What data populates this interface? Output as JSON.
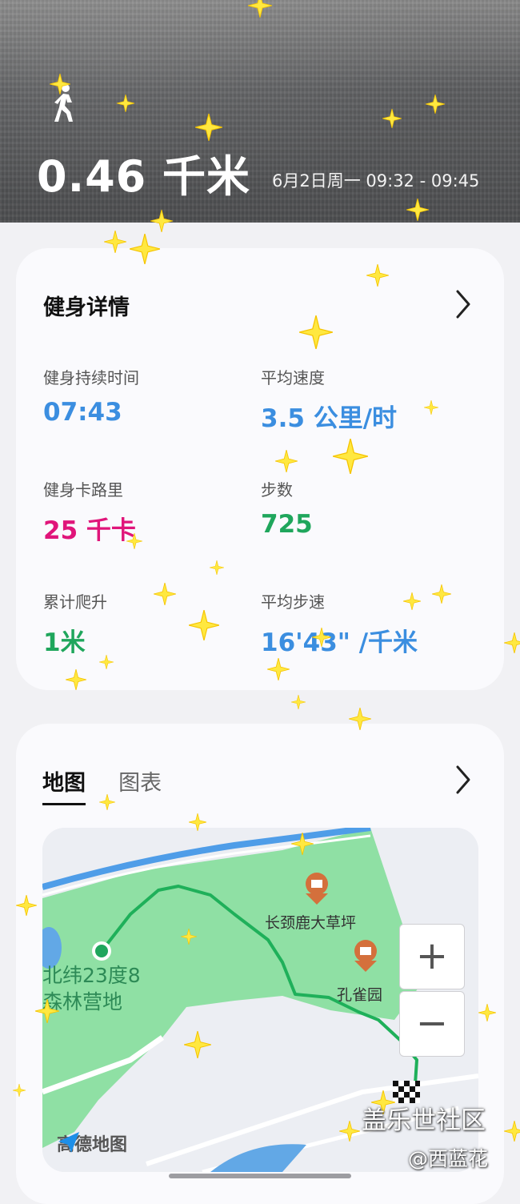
{
  "header": {
    "distance": "0.46 千米",
    "time_range": "6月2日周一 09:32 - 09:45",
    "activity_icon": "walking-icon"
  },
  "fitness_details": {
    "title": "健身详情",
    "stats": [
      {
        "label": "健身持续时间",
        "value": "07:43",
        "color": "#3b8ee0"
      },
      {
        "label": "平均速度",
        "value": "3.5 公里/时",
        "color": "#3b8ee0"
      },
      {
        "label": "健身卡路里",
        "value": "25 千卡",
        "color": "#e0157a"
      },
      {
        "label": "步数",
        "value": "725",
        "color": "#1fa65c"
      },
      {
        "label": "累计爬升",
        "value": "1米",
        "color": "#1fa65c"
      },
      {
        "label": "平均步速",
        "value": "16'43\" /千米",
        "color": "#3b8ee0"
      }
    ]
  },
  "map_section": {
    "tabs": [
      {
        "label": "地图",
        "active": true
      },
      {
        "label": "图表",
        "active": false
      }
    ],
    "map": {
      "poi_1": "长颈鹿大草坪",
      "poi_2": "孔雀园",
      "campsite": "北纬23度8",
      "campsite_2": "森林营地",
      "zoom_in": "+",
      "zoom_out": "−",
      "provider": "高德地图"
    }
  },
  "watermark": {
    "line1": "盖乐世社区",
    "line2": "@西蓝花"
  }
}
